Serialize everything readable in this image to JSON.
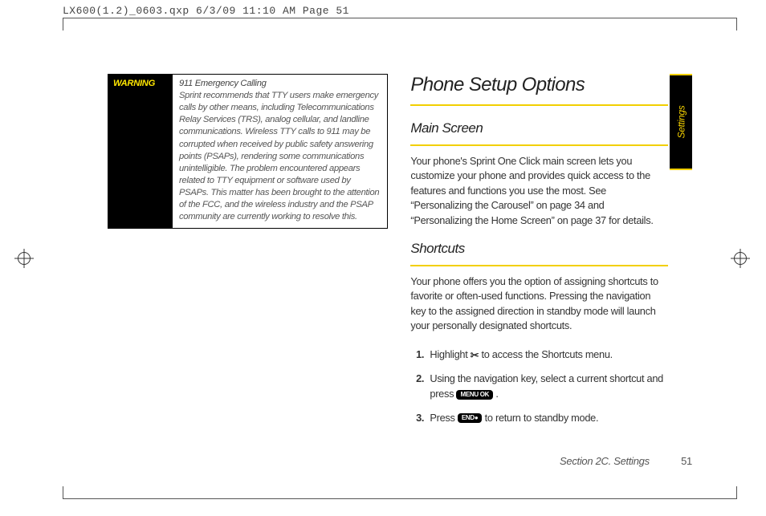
{
  "header_print_info": "LX600(1.2)_0603.qxp  6/3/09  11:10 AM  Page 51",
  "side_tab": "Settings",
  "warning": {
    "label": "WARNING",
    "lead": "911 Emergency Calling",
    "body": "Sprint recommends that TTY users make emergency calls by other means, including Telecommunications Relay Services (TRS), analog cellular, and landline communications. Wireless TTY calls to 911 may be corrupted when received by public safety answering points (PSAPs), rendering some communications unintelligible. The problem encountered appears related to TTY equipment or software used by PSAPs. This matter has been brought to the attention of the FCC, and the wireless industry and the PSAP community are currently working to resolve this."
  },
  "right": {
    "title": "Phone Setup Options",
    "main_screen": {
      "heading": "Main Screen",
      "body": "Your phone's Sprint One Click main screen lets you customize your phone and provides quick access to the features and functions you use the most. See “Personalizing the Carousel” on page 34 and “Personalizing the Home Screen” on page 37 for details."
    },
    "shortcuts": {
      "heading": "Shortcuts",
      "body": "Your phone offers you the option of assigning shortcuts to favorite or often-used functions. Pressing the navigation key to the assigned direction in standby mode will launch your personally designated shortcuts.",
      "steps": {
        "s1a": "Highlight ",
        "s1b": " to access the Shortcuts menu.",
        "s2a": "Using the navigation key, select a current shortcut and press ",
        "s2b": ".",
        "s3a": "Press ",
        "s3b": " to return to standby mode."
      },
      "keys": {
        "tool": "✂",
        "ok": "MENU OK",
        "end": "END●"
      }
    }
  },
  "footer": {
    "section": "Section 2C. Settings",
    "page": "51"
  }
}
